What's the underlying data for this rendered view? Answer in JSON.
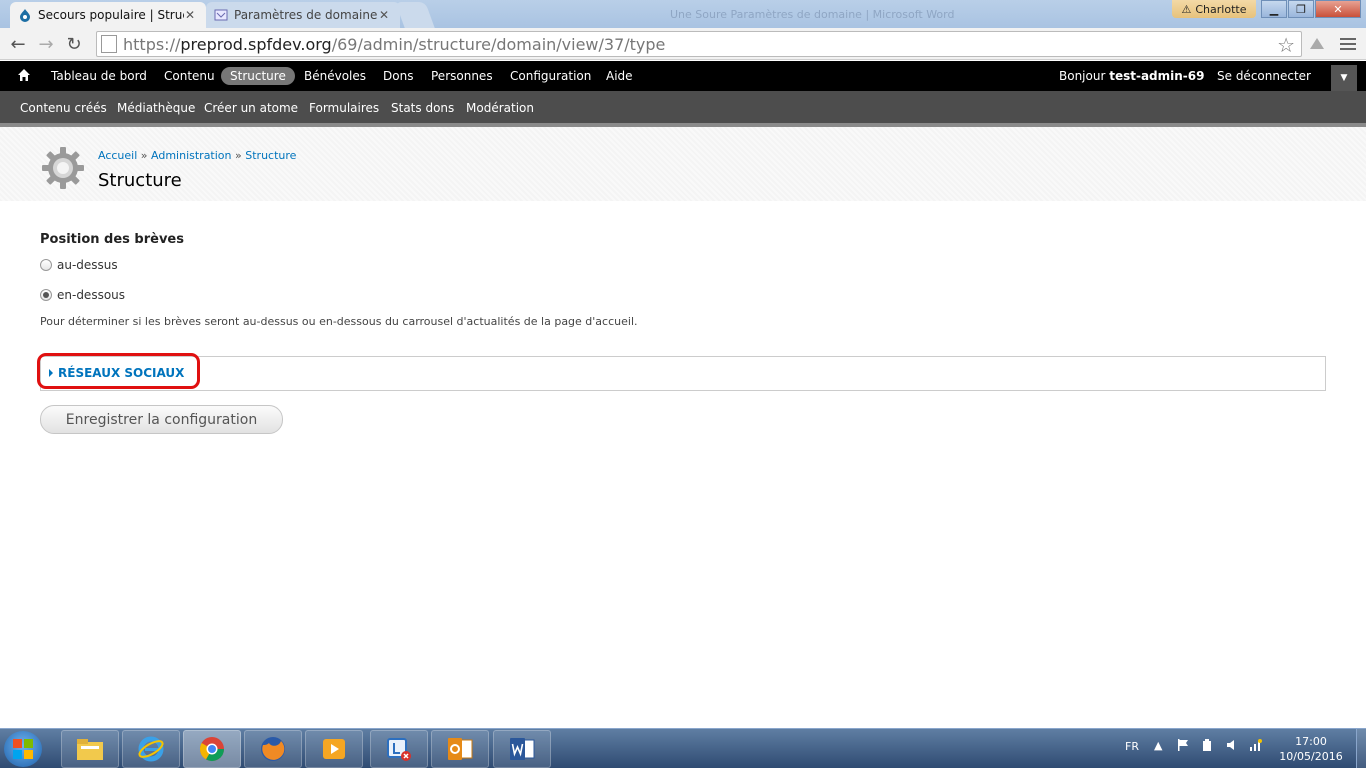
{
  "browser": {
    "tabs": [
      {
        "title": "Secours populaire | Struct",
        "close": "✕"
      },
      {
        "title": "Paramètres de domaine",
        "close": "✕"
      }
    ],
    "window_title": "Une Soure Paramètres de domaine | Microsoft Word",
    "user": "Charlotte",
    "url_scheme": "https://",
    "url_host": "preprod.spfdev.org",
    "url_path": "/69/admin/structure/domain/view/37/type"
  },
  "admin_toolbar": {
    "items": [
      "Tableau de bord",
      "Contenu",
      "Structure",
      "Bénévoles",
      "Dons",
      "Personnes",
      "Configuration",
      "Aide"
    ],
    "active": "Structure",
    "greeting": "Bonjour ",
    "username": "test-admin-69",
    "logout": "Se déconnecter"
  },
  "shortcuts": [
    "Contenu créés",
    "Médiathèque",
    "Créer un atome",
    "Formulaires",
    "Stats dons",
    "Modération"
  ],
  "breadcrumb": {
    "items": [
      "Accueil",
      "Administration",
      "Structure"
    ],
    "separator": "»"
  },
  "page_title": "Structure",
  "form": {
    "label": "Position des brèves",
    "options": [
      {
        "label": "au-dessus",
        "checked": false
      },
      {
        "label": "en-dessous",
        "checked": true
      }
    ],
    "help": "Pour déterminer si les brèves seront au-dessus ou en-dessous du carrousel d'actualités de la page d'accueil.",
    "fieldset_legend": "RÉSEAUX SOCIAUX",
    "submit": "Enregistrer la configuration"
  },
  "taskbar": {
    "language": "FR",
    "time": "17:00",
    "date": "10/05/2016"
  },
  "colors": {
    "link": "#0074bd",
    "annotation": "#e01010",
    "admin_bar": "#000000"
  }
}
